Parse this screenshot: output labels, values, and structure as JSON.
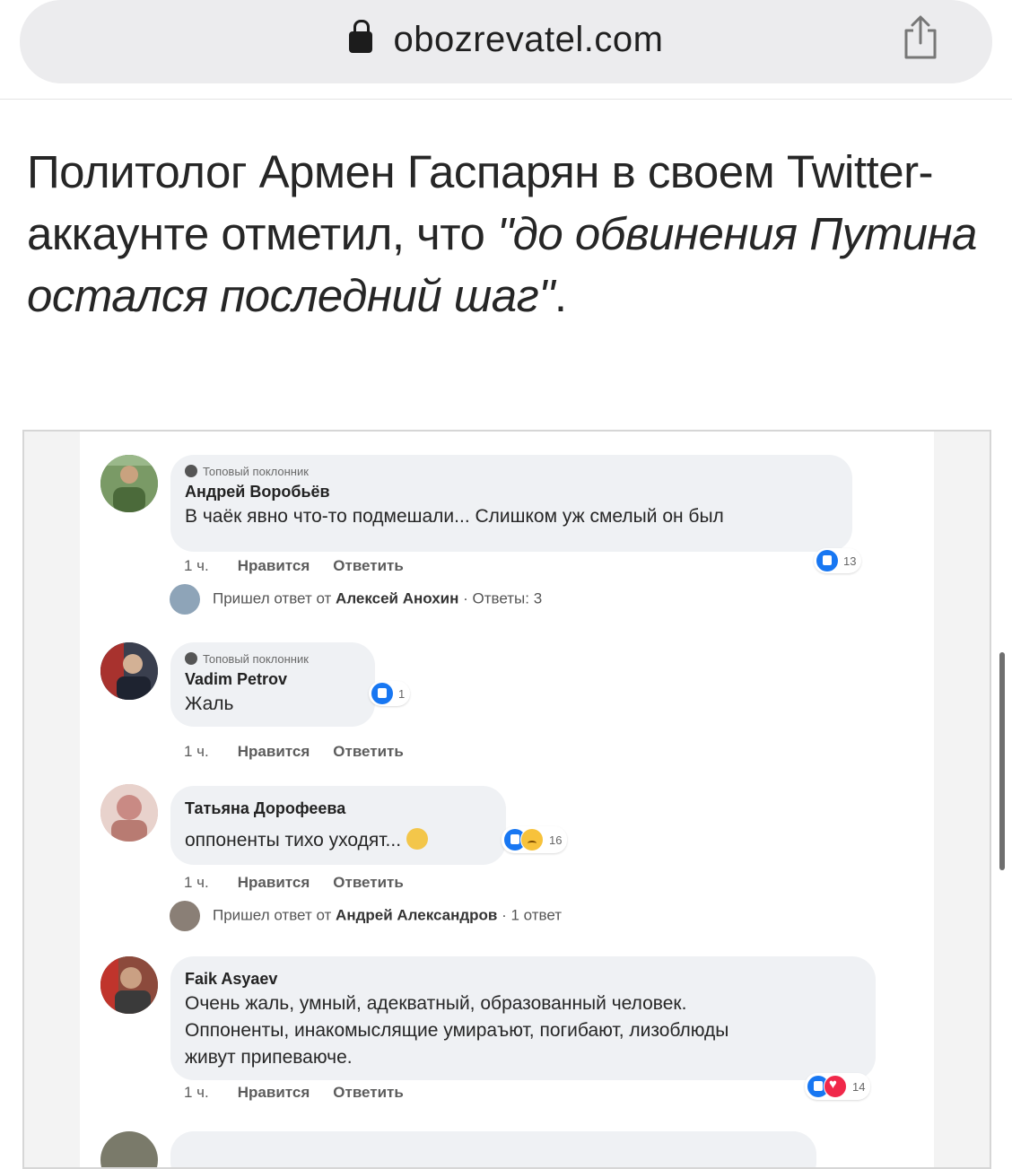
{
  "browser": {
    "url": "obozrevatel.com"
  },
  "article": {
    "text_plain": "Политолог Армен Гаспарян в своем Twitter-аккаунте отметил, что ",
    "quote": "\"до обвинения Путина остался последний шаг\"",
    "period": "."
  },
  "comments": [
    {
      "badge": "Топовый поклонник",
      "author": "Андрей Воробьёв",
      "text": "В чаёк явно что-то подмешали... Слишком уж смелый он был",
      "time": "1 ч.",
      "like": "Нравится",
      "reply": "Ответить",
      "reaction_count": "13",
      "reply_notice": {
        "prefix": "Пришел ответ от ",
        "name": "Алексей Анохин",
        "suffix": " · Ответы: 3"
      }
    },
    {
      "badge": "Топовый поклонник",
      "author": "Vadim Petrov",
      "text": "Жаль",
      "time": "1 ч.",
      "like": "Нравится",
      "reply": "Ответить",
      "reaction_count": "1"
    },
    {
      "author": "Татьяна Дорофеева",
      "text": "оппоненты тихо уходят...",
      "time": "1 ч.",
      "like": "Нравится",
      "reply": "Ответить",
      "reaction_count": "16",
      "reply_notice": {
        "prefix": "Пришел ответ от ",
        "name": "Андрей Александров",
        "suffix": " · 1 ответ"
      }
    },
    {
      "author": "Faik Asyaev",
      "text_lines": [
        "Очень жаль, умный, адекватный, образованный человек.",
        "Оппоненты, инакомыслящие умираъют, погибают, лизоблюды",
        "живут припеваюче."
      ],
      "time": "1 ч.",
      "like": "Нравится",
      "reply": "Ответить",
      "reaction_count": "14"
    }
  ],
  "colors": {
    "like_blue": "#1877f2",
    "love_red": "#f0284a",
    "bubble_bg": "#eff1f4"
  }
}
